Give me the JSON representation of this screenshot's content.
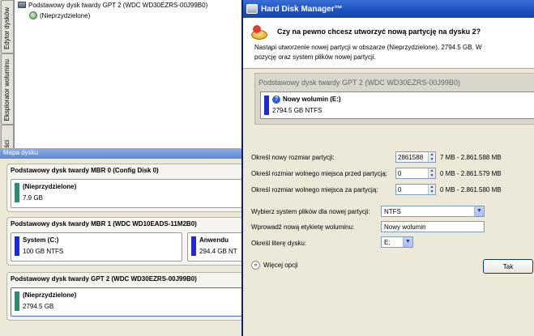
{
  "side_tabs": [
    "Edytor dysków",
    "Eksplorator woluminu",
    "ści"
  ],
  "tree": {
    "disk_label": "Podstawowy dysk twardy GPT 2 (WDC WD30EZRS-00J99B0)",
    "item_label": "(Nieprzydzielone)"
  },
  "disk_map": {
    "title": "Mapa dysku",
    "disks": [
      {
        "label": "Podstawowy dysk twardy MBR 0 (Config   Disk 0)",
        "partitions": [
          {
            "name": "(Nieprzydzielone)",
            "size": "7.9 GB",
            "color": "#2e8b6e"
          }
        ]
      },
      {
        "label": "Podstawowy dysk twardy MBR 1 (WDC WD10EADS-11M2B0)",
        "partitions": [
          {
            "name": "System (C:)",
            "size": "100 GB NTFS",
            "color": "#1a2cd9"
          },
          {
            "name": "Anwendu",
            "size": "294.4 GB NT",
            "color": "#1a2cd9"
          }
        ]
      },
      {
        "label": "Podstawowy dysk twardy GPT 2 (WDC WD30EZRS-00J99B0)",
        "partitions": [
          {
            "name": "(Nieprzydzielone)",
            "size": "2794.5 GB",
            "color": "#2e8b6e"
          }
        ]
      }
    ]
  },
  "dialog": {
    "title": "Hard Disk Manager™",
    "question": "Czy na pewno chcesz utworzyć nową partycję na dysku 2?",
    "desc_line1": "Nastąpi utworzenie nowej partycji w obszarze (Nieprzydzielone), 2794.5 GB. W",
    "desc_line2": "pozycję oraz system plików nowej partycji.",
    "preview": {
      "disk_label": "Podstawowy dysk twardy GPT 2 (WDC WD30EZRS-00J99B0)",
      "volume_name": "Nowy wolumin (E:)",
      "volume_size": "2794.5 GB NTFS"
    },
    "fields": {
      "size_label": "Określ nowy rozmiar partycji:",
      "size_value": "2861588",
      "size_range": "7 MB - 2.861.588 MB",
      "before_label": "Określ rozmiar wolnego miejsca przed partycją:",
      "before_value": "0",
      "before_range": "0 MB - 2.861.579 MB",
      "after_label": "Określ rozmiar wolnego miejsca za partycją:",
      "after_value": "0",
      "after_range": "0 MB - 2.861.580 MB",
      "fs_label": "Wybierz system plików dla nowej partycji:",
      "fs_value": "NTFS",
      "volname_label": "Wprowadź nową etykietę woluminu:",
      "volname_value": "Nowy wolumin",
      "letter_label": "Określ literę dysku:",
      "letter_value": "E:"
    },
    "more_options": "Więcej opcji",
    "ok_label": "Tak"
  }
}
